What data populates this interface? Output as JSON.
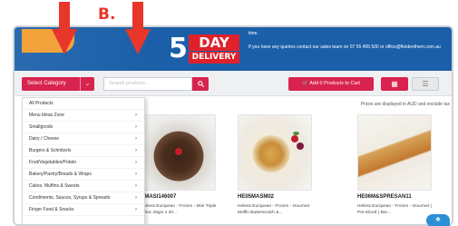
{
  "annotation": {
    "label": "B."
  },
  "banner": {
    "promo_number": "5",
    "promo_word": "DAY",
    "promo_word2": "DELIVERY",
    "line1": "time.",
    "line2": "If you have any queries contact our sales team on 07 55 495 500 or office@fleidenthorn.com.au"
  },
  "toolbar": {
    "category_label": "Select Category",
    "search_placeholder": "Search products...",
    "cart_label": "Add 0 Products to Cart"
  },
  "menu": {
    "items": [
      {
        "label": "All Products",
        "has_arrow": false
      },
      {
        "label": "Menu Ideas Zone",
        "has_arrow": true
      },
      {
        "label": "Smallgoods",
        "has_arrow": true
      },
      {
        "label": "Dairy / Cheese",
        "has_arrow": true
      },
      {
        "label": "Burgers & Schnitzels",
        "has_arrow": true
      },
      {
        "label": "Fruit/Vegetables/Potato",
        "has_arrow": true
      },
      {
        "label": "Bakery/Pastry/Breads & Wraps",
        "has_arrow": true
      },
      {
        "label": "Cakes, Muffins & Sweets",
        "has_arrow": true
      },
      {
        "label": "Condiments, Sauces, Syrups & Spreads",
        "has_arrow": true
      },
      {
        "label": "Finger Food & Snacks",
        "has_arrow": true
      }
    ]
  },
  "prices_note": "Prices are displayed in AUD and exclude tax",
  "products": [
    {
      "code": "5MASI146007",
      "desc": "Helens European - Frozen - Mini Triple Choc 25gm x 20..."
    },
    {
      "code": "HE05MASM02",
      "desc": "Helens European - Frozen - Gourmet Muffin Butterscotch &..."
    },
    {
      "code": "HE06M&SPRESAN11",
      "desc": "Helens European - Frozen - Gourmet ( Pre-sliced ) Bre..."
    }
  ],
  "colors": {
    "accent": "#d8234e",
    "banner": "#1b5fa8",
    "annotation": "#e8362a"
  }
}
